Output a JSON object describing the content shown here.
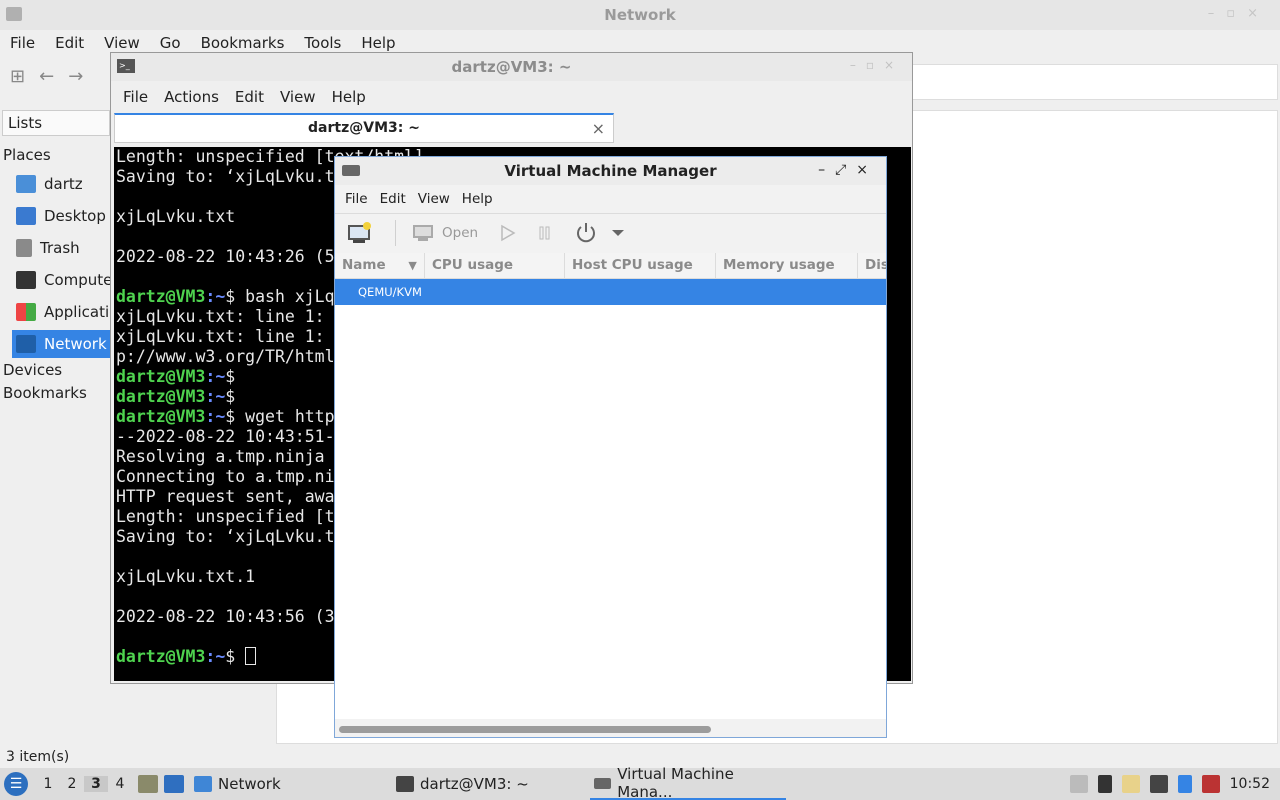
{
  "file_manager": {
    "title": "Network",
    "menu": [
      "File",
      "Edit",
      "View",
      "Go",
      "Bookmarks",
      "Tools",
      "Help"
    ],
    "sidebar_selector": "Lists",
    "places_header": "Places",
    "places": [
      "dartz",
      "Desktop",
      "Trash",
      "Computer",
      "Applications",
      "Network"
    ],
    "devices_header": "Devices",
    "bookmarks_header": "Bookmarks",
    "status": "3 item(s)"
  },
  "terminal": {
    "title": "dartz@VM3: ~",
    "menu": [
      "File",
      "Actions",
      "Edit",
      "View",
      "Help"
    ],
    "tab_label": "dartz@VM3: ~",
    "lines": [
      {
        "t": "Length: unspecified [text/html]"
      },
      {
        "t": "Saving to: ‘xjLqLvku.txt’"
      },
      {
        "t": ""
      },
      {
        "t": "xjLqLvku.txt"
      },
      {
        "t": ""
      },
      {
        "t": "2022-08-22 10:43:26 (5"
      },
      {
        "t": ""
      },
      {
        "user": "dartz@VM3",
        "path": ":~",
        "cmd": "$ bash xjLq"
      },
      {
        "t": "xjLqLvku.txt: line 1:"
      },
      {
        "t": "xjLqLvku.txt: line 1:"
      },
      {
        "t": "p://www.w3.org/TR/html"
      },
      {
        "user": "dartz@VM3",
        "path": ":~",
        "cmd": "$"
      },
      {
        "user": "dartz@VM3",
        "path": ":~",
        "cmd": "$"
      },
      {
        "user": "dartz@VM3",
        "path": ":~",
        "cmd": "$ wget http"
      },
      {
        "t": "--2022-08-22 10:43:51-"
      },
      {
        "t": "Resolving a.tmp.ninja"
      },
      {
        "t": "Connecting to a.tmp.ni"
      },
      {
        "t": "HTTP request sent, awa"
      },
      {
        "t": "Length: unspecified [t"
      },
      {
        "t": "Saving to: ‘xjLqLvku.t"
      },
      {
        "t": ""
      },
      {
        "t": "xjLqLvku.txt.1"
      },
      {
        "t": ""
      },
      {
        "t": "2022-08-22 10:43:56 (3"
      },
      {
        "t": ""
      },
      {
        "user": "dartz@VM3",
        "path": ":~",
        "cmd": "$ ",
        "cursor": true
      }
    ]
  },
  "vmm": {
    "title": "Virtual Machine Manager",
    "menu": [
      "File",
      "Edit",
      "View",
      "Help"
    ],
    "open_label": "Open",
    "columns": [
      "Name",
      "CPU usage",
      "Host CPU usage",
      "Memory usage",
      "Dis"
    ],
    "rows": [
      "QEMU/KVM"
    ]
  },
  "taskbar": {
    "workspaces": [
      "1",
      "2",
      "3",
      "4"
    ],
    "active_workspace": "3",
    "tasks": [
      "Network",
      "dartz@VM3: ~",
      "Virtual Machine Mana..."
    ],
    "clock": "10:52"
  }
}
